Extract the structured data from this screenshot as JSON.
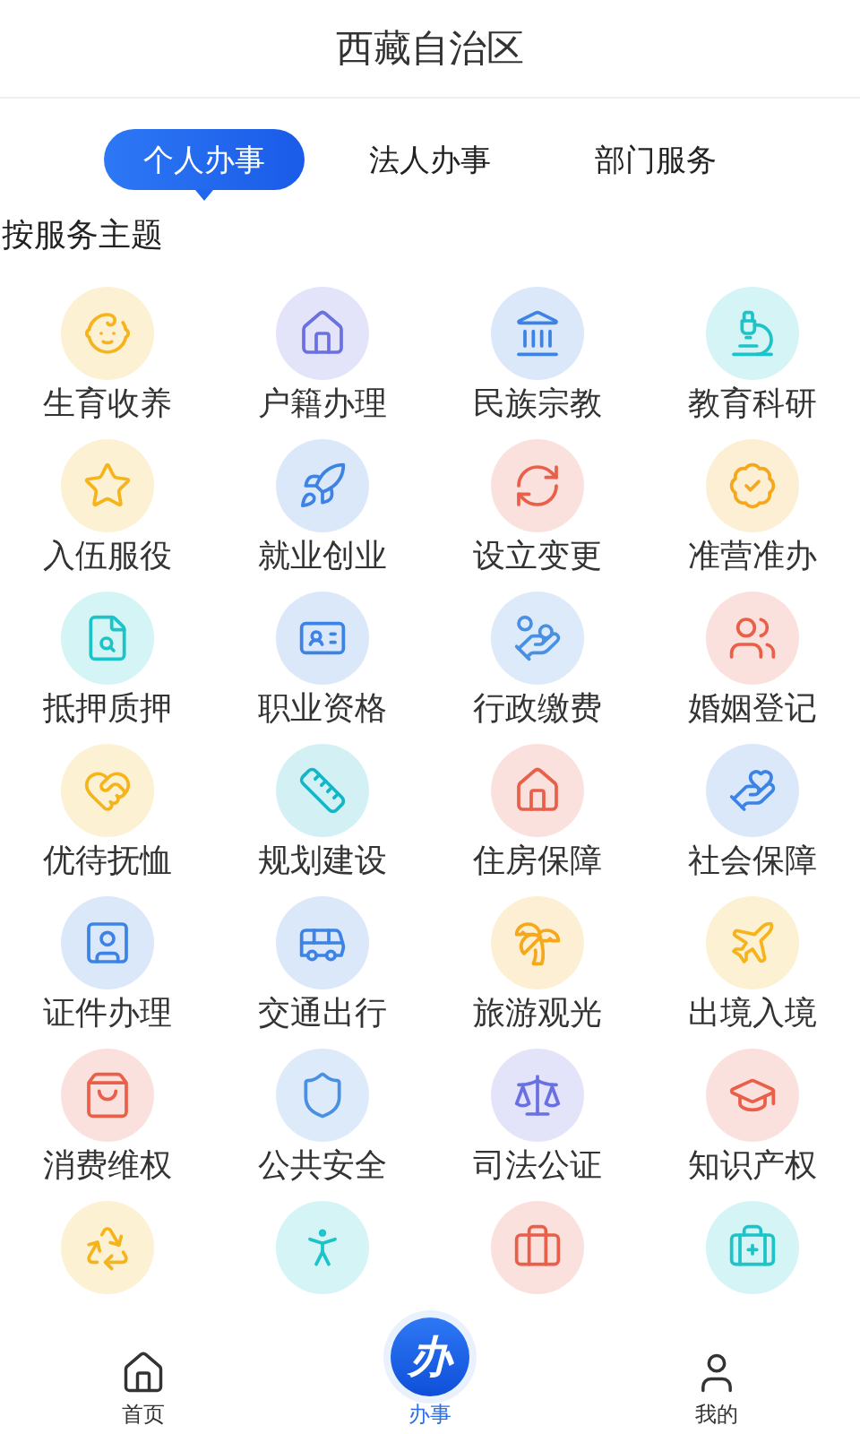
{
  "header": {
    "title": "西藏自治区"
  },
  "tabs": [
    {
      "label": "个人办事",
      "selected": true
    },
    {
      "label": "法人办事",
      "selected": false
    },
    {
      "label": "部门服务",
      "selected": false
    }
  ],
  "section_title": "按服务主题",
  "services": [
    {
      "label": "生育收养",
      "color": "#f5b31c"
    },
    {
      "label": "户籍办理",
      "color": "#6b70e0"
    },
    {
      "label": "民族宗教",
      "color": "#3d83e6"
    },
    {
      "label": "教育科研",
      "color": "#1cc3c9"
    },
    {
      "label": "入伍服役",
      "color": "#f5b31c"
    },
    {
      "label": "就业创业",
      "color": "#3d83e6"
    },
    {
      "label": "设立变更",
      "color": "#e8604a"
    },
    {
      "label": "准营准办",
      "color": "#f5a81c"
    },
    {
      "label": "抵押质押",
      "color": "#1cc3c9"
    },
    {
      "label": "职业资格",
      "color": "#3d83e6"
    },
    {
      "label": "行政缴费",
      "color": "#4a90e2"
    },
    {
      "label": "婚姻登记",
      "color": "#e8604a"
    },
    {
      "label": "优待抚恤",
      "color": "#f5b31c"
    },
    {
      "label": "规划建设",
      "color": "#17b5c4"
    },
    {
      "label": "住房保障",
      "color": "#e8604a"
    },
    {
      "label": "社会保障",
      "color": "#3d83e6"
    },
    {
      "label": "证件办理",
      "color": "#3d83e6"
    },
    {
      "label": "交通出行",
      "color": "#3d83e6"
    },
    {
      "label": "旅游观光",
      "color": "#f5a81c"
    },
    {
      "label": "出境入境",
      "color": "#f5b31c"
    },
    {
      "label": "消费维权",
      "color": "#e8604a"
    },
    {
      "label": "公共安全",
      "color": "#4a90e2"
    },
    {
      "label": "司法公证",
      "color": "#6b70e0"
    },
    {
      "label": "知识产权",
      "color": "#e8604a"
    },
    {
      "color": "#f5b31c"
    },
    {
      "color": "#1cc3c9"
    },
    {
      "color": "#e8604a"
    },
    {
      "color": "#1cc3c9"
    }
  ],
  "bottom_nav": [
    {
      "kind": "home",
      "label": "首页",
      "selected": false
    },
    {
      "kind": "fab",
      "badge": "办",
      "label": "办事",
      "selected": true
    },
    {
      "kind": "profile",
      "label": "我的",
      "selected": false
    }
  ]
}
